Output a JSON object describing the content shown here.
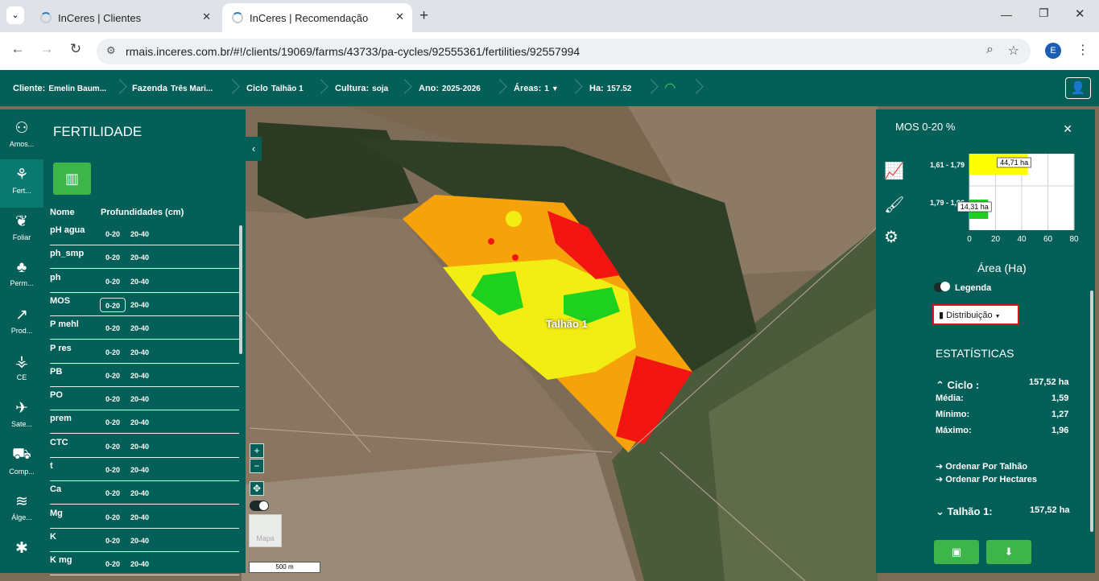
{
  "browser": {
    "tabs": [
      {
        "title": "InCeres | Clientes"
      },
      {
        "title": "InCeres | Recomendação",
        "active": true
      }
    ],
    "url": "rmais.inceres.com.br/#!/clients/19069/farms/43733/pa-cycles/92555361/fertilities/92557994",
    "profile_initial": "E"
  },
  "appbar": {
    "cliente_label": "Cliente:",
    "cliente": "Emelin Baum...",
    "fazenda_label": "Fazenda",
    "fazenda": "Três Mari...",
    "ciclo_label": "Ciclo",
    "ciclo": "Talhão 1",
    "cultura_label": "Cultura:",
    "cultura": "soja",
    "ano_label": "Ano:",
    "ano": "2025-2026",
    "areas_label": "Áreas:",
    "areas": "1",
    "ha_label": "Ha:",
    "ha": "157.52"
  },
  "iconbar": [
    {
      "label": "Amos...",
      "icon": "soil-sample-icon",
      "glyph": "⚇"
    },
    {
      "label": "Fert...",
      "icon": "fertility-icon",
      "glyph": "⚘",
      "active": true
    },
    {
      "label": "Foliar",
      "icon": "leaf-icon",
      "glyph": "❦"
    },
    {
      "label": "Perm...",
      "icon": "plant-icon",
      "glyph": "♣"
    },
    {
      "label": "Prod...",
      "icon": "chart-line-icon",
      "glyph": "↗"
    },
    {
      "label": "CE",
      "icon": "sprout-icon",
      "glyph": "⚶"
    },
    {
      "label": "Sate...",
      "icon": "satellite-icon",
      "glyph": "✈"
    },
    {
      "label": "Comp...",
      "icon": "tractor-icon",
      "glyph": "⛟"
    },
    {
      "label": "Álge...",
      "icon": "layers-icon",
      "glyph": "≋"
    },
    {
      "label": "",
      "icon": "bug-icon",
      "glyph": "✱"
    }
  ],
  "left_panel": {
    "title": "FERTILIDADE",
    "col_name": "Nome",
    "col_depth": "Profundidades (cm)",
    "rows": [
      {
        "name": "pH agua",
        "d1": "0-20",
        "d2": "20-40"
      },
      {
        "name": "ph_smp",
        "d1": "0-20",
        "d2": "20-40"
      },
      {
        "name": "ph",
        "d1": "0-20",
        "d2": "20-40"
      },
      {
        "name": "MOS",
        "d1": "0-20",
        "d2": "20-40",
        "selected": true
      },
      {
        "name": "P mehl",
        "d1": "0-20",
        "d2": "20-40"
      },
      {
        "name": "P res",
        "d1": "0-20",
        "d2": "20-40"
      },
      {
        "name": "PB",
        "d1": "0-20",
        "d2": "20-40"
      },
      {
        "name": "PO",
        "d1": "0-20",
        "d2": "20-40"
      },
      {
        "name": "prem",
        "d1": "0-20",
        "d2": "20-40"
      },
      {
        "name": "CTC",
        "d1": "0-20",
        "d2": "20-40"
      },
      {
        "name": "t",
        "d1": "0-20",
        "d2": "20-40"
      },
      {
        "name": "Ca",
        "d1": "0-20",
        "d2": "20-40"
      },
      {
        "name": "Mg",
        "d1": "0-20",
        "d2": "20-40"
      },
      {
        "name": "K",
        "d1": "0-20",
        "d2": "20-40"
      },
      {
        "name": "K mg",
        "d1": "0-20",
        "d2": "20-40"
      }
    ]
  },
  "map": {
    "field_label": "Talhão 1",
    "zoom_in": "+",
    "zoom_out": "−",
    "basemap_label": "Mapa",
    "scale_label": "500 m"
  },
  "right_panel": {
    "title": "MOS 0-20 %",
    "legend_label": "Legenda",
    "distribution_label": "Distribuição",
    "stats_title": "ESTATÍSTICAS",
    "ciclo_label": "Ciclo :",
    "ciclo_value": "157,52 ha",
    "media_label": "Média:",
    "media_value": "1,59",
    "minimo_label": "Mínimo:",
    "minimo_value": "1,27",
    "maximo_label": "Máximo:",
    "maximo_value": "1,96",
    "order_talhao": "Ordenar Por Talhão",
    "order_hectares": "Ordenar Por Hectares",
    "talhao_label": "Talhão 1:",
    "talhao_value": "157,52 ha"
  },
  "chart_data": {
    "type": "bar",
    "orientation": "horizontal",
    "categories": [
      "1,61 - 1,79",
      "1,79 - 1,96"
    ],
    "values": [
      44.71,
      14.31
    ],
    "data_labels": [
      "44,71 ha",
      "14,31 ha"
    ],
    "colors": [
      "#ffff00",
      "#22cc22"
    ],
    "xlabel": "Área (Ha)",
    "xticks": [
      "0",
      "20",
      "40",
      "60",
      "80"
    ],
    "xlim": [
      0,
      80
    ]
  }
}
